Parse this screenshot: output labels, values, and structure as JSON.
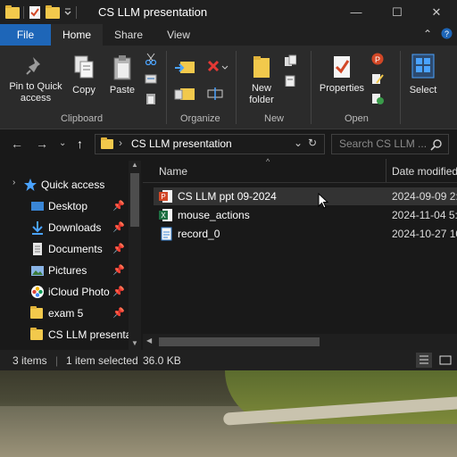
{
  "window": {
    "title": "CS LLM presentation",
    "controls": {
      "minimize": "—",
      "maximize": "☐",
      "close": "✕"
    }
  },
  "tabs": {
    "file": "File",
    "home": "Home",
    "share": "Share",
    "view": "View"
  },
  "ribbon": {
    "pin_label": "Pin to Quick access",
    "copy_label": "Copy",
    "paste_label": "Paste",
    "new_folder_label": "New folder",
    "properties_label": "Properties",
    "select_label": "Select",
    "groups": {
      "clipboard": "Clipboard",
      "organize": "Organize",
      "new": "New",
      "open": "Open"
    }
  },
  "address": {
    "path": "CS LLM presentation",
    "search_placeholder": "Search CS LLM ..."
  },
  "sidebar": {
    "items": [
      {
        "label": "Quick access",
        "icon": "star-icon",
        "pinned": false
      },
      {
        "label": "Desktop",
        "icon": "desktop-icon",
        "pinned": true
      },
      {
        "label": "Downloads",
        "icon": "download-icon",
        "pinned": true
      },
      {
        "label": "Documents",
        "icon": "documents-icon",
        "pinned": true
      },
      {
        "label": "Pictures",
        "icon": "pictures-icon",
        "pinned": true
      },
      {
        "label": "iCloud Photo",
        "icon": "icloud-photos-icon",
        "pinned": true
      },
      {
        "label": "exam 5",
        "icon": "folder-icon",
        "pinned": true
      },
      {
        "label": "CS LLM presenta",
        "icon": "folder-icon",
        "pinned": false
      }
    ]
  },
  "columns": {
    "name": "Name",
    "date_modified": "Date modified"
  },
  "files": [
    {
      "name": "CS LLM ppt 09-2024",
      "date": "2024-09-09 2:3",
      "type": "powerpoint",
      "selected": true
    },
    {
      "name": "mouse_actions",
      "date": "2024-11-04 5:0",
      "type": "excel",
      "selected": false
    },
    {
      "name": "record_0",
      "date": "2024-10-27 10",
      "type": "text",
      "selected": false
    }
  ],
  "status": {
    "items": "3 items",
    "selected": "1 item selected",
    "size": "36.0 KB"
  },
  "colors": {
    "accent": "#1e66b8",
    "folder": "#f2c94c",
    "powerpoint": "#d24726",
    "excel": "#1d6f42"
  }
}
